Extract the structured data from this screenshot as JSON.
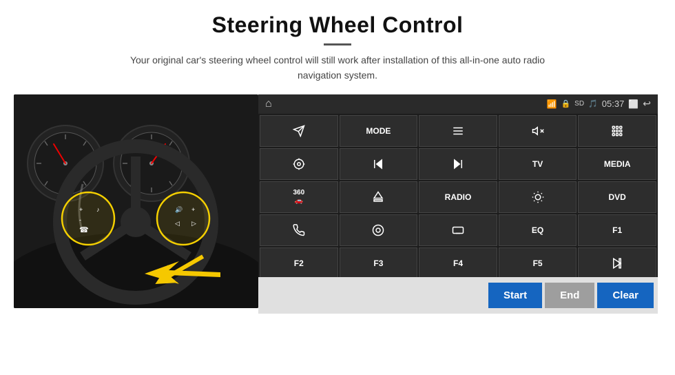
{
  "page": {
    "title": "Steering Wheel Control",
    "subtitle": "Your original car's steering wheel control will still work after installation of this all-in-one auto radio navigation system.",
    "divider": true
  },
  "statusBar": {
    "homeIcon": "⌂",
    "wifiIcon": "wifi",
    "lockIcon": "🔒",
    "sdIcon": "SD",
    "btIcon": "BT",
    "time": "05:37",
    "windowIcon": "⬜",
    "backIcon": "↩"
  },
  "buttons": [
    {
      "id": "row1",
      "cells": [
        {
          "label": "",
          "icon": "send",
          "type": "icon"
        },
        {
          "label": "MODE",
          "type": "text"
        },
        {
          "label": "",
          "icon": "list",
          "type": "icon"
        },
        {
          "label": "",
          "icon": "mute",
          "type": "icon"
        },
        {
          "label": "",
          "icon": "apps",
          "type": "icon"
        }
      ]
    },
    {
      "id": "row2",
      "cells": [
        {
          "label": "",
          "icon": "settings-circle",
          "type": "icon"
        },
        {
          "label": "",
          "icon": "prev",
          "type": "icon"
        },
        {
          "label": "",
          "icon": "next",
          "type": "icon"
        },
        {
          "label": "TV",
          "type": "text"
        },
        {
          "label": "MEDIA",
          "type": "text"
        }
      ]
    },
    {
      "id": "row3",
      "cells": [
        {
          "label": "",
          "icon": "360-car",
          "type": "icon"
        },
        {
          "label": "",
          "icon": "eject",
          "type": "icon"
        },
        {
          "label": "RADIO",
          "type": "text"
        },
        {
          "label": "",
          "icon": "brightness",
          "type": "icon"
        },
        {
          "label": "DVD",
          "type": "text"
        }
      ]
    },
    {
      "id": "row4",
      "cells": [
        {
          "label": "",
          "icon": "phone",
          "type": "icon"
        },
        {
          "label": "",
          "icon": "spiral",
          "type": "icon"
        },
        {
          "label": "",
          "icon": "screen",
          "type": "icon"
        },
        {
          "label": "EQ",
          "type": "text"
        },
        {
          "label": "F1",
          "type": "text"
        }
      ]
    },
    {
      "id": "row5",
      "cells": [
        {
          "label": "F2",
          "type": "text"
        },
        {
          "label": "F3",
          "type": "text"
        },
        {
          "label": "F4",
          "type": "text"
        },
        {
          "label": "F5",
          "type": "text"
        },
        {
          "label": "",
          "icon": "play-pause",
          "type": "icon"
        }
      ]
    },
    {
      "id": "row6",
      "cells": [
        {
          "label": "",
          "icon": "music-note",
          "type": "icon"
        },
        {
          "label": "",
          "icon": "mic",
          "type": "icon"
        },
        {
          "label": "",
          "icon": "vol-phone",
          "type": "icon"
        },
        {
          "label": "",
          "icon": "blank",
          "type": "icon"
        },
        {
          "label": "",
          "icon": "blank",
          "type": "icon"
        }
      ]
    }
  ],
  "actionBar": {
    "startLabel": "Start",
    "endLabel": "End",
    "clearLabel": "Clear"
  }
}
